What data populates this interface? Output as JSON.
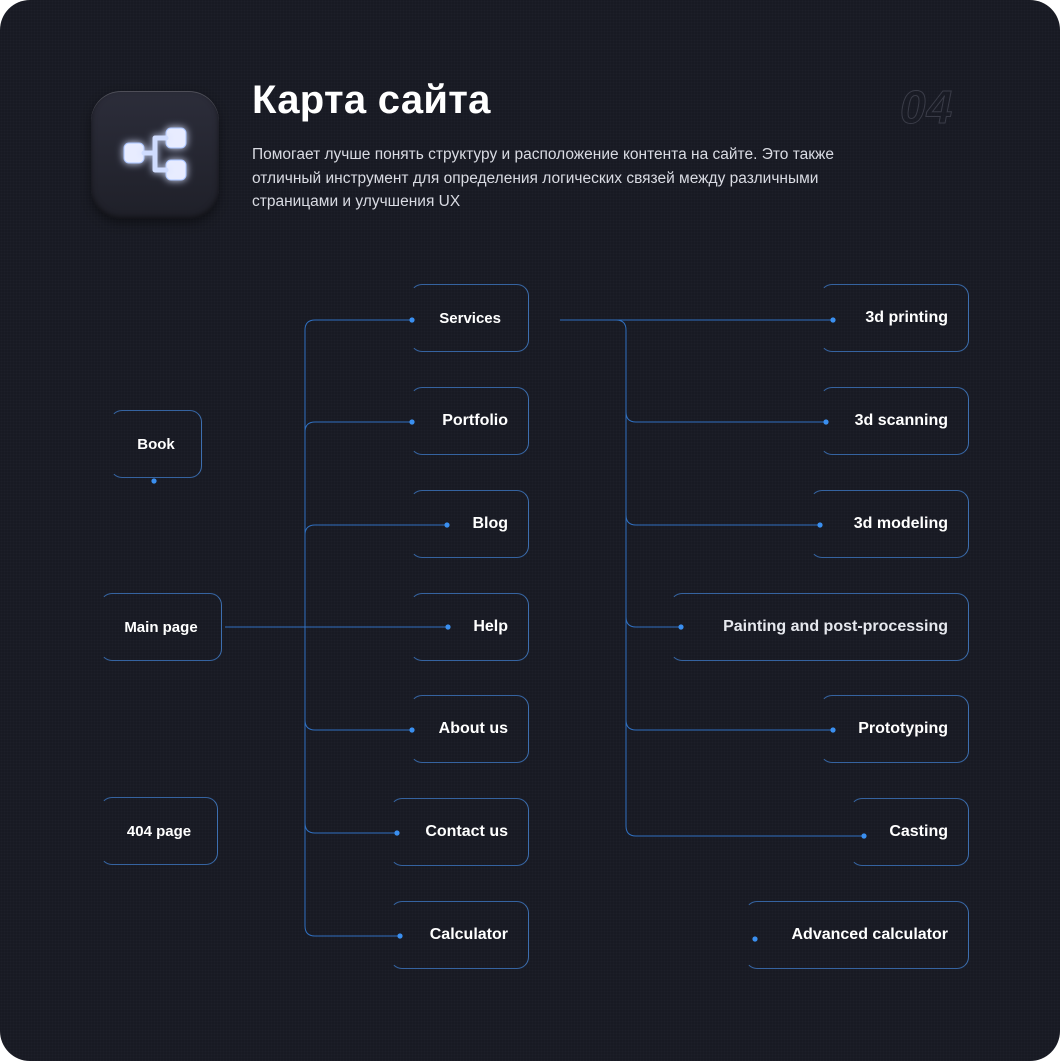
{
  "header": {
    "title": "Карта сайта",
    "description": "Помогает лучше понять структуру и расположение контента на сайте. Это также отличный инструмент для определения логических связей между различными страницами и улучшения UX",
    "number": "04"
  },
  "nodes": {
    "book": "Book",
    "main_page": "Main page",
    "page_404": "404 page",
    "services": "Services",
    "portfolio": "Portfolio",
    "blog": "Blog",
    "help": "Help",
    "about_us": "About us",
    "contact_us": "Contact us",
    "calculator": "Calculator",
    "printing": "3d printing",
    "scanning": "3d scanning",
    "modeling": "3d modeling",
    "painting": "Painting and post-processing",
    "prototyping": "Prototyping",
    "casting": "Casting",
    "advanced_calculator": "Advanced calculator"
  },
  "colors": {
    "background": "#181a23",
    "accent": "#3a8ff0",
    "border": "#3d6fb0"
  },
  "icon": "sitemap-icon"
}
